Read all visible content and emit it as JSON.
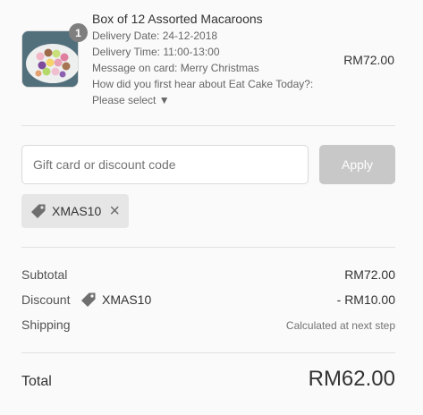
{
  "cart_item": {
    "quantity": "1",
    "title": "Box of 12 Assorted Macaroons",
    "properties": [
      "Delivery Date: 24-12-2018",
      "Delivery Time: 11:00-13:00",
      "Message on card: Merry Christmas",
      "How did you first hear about Eat Cake Today?:"
    ],
    "select_label": "Please select",
    "price": "RM72.00"
  },
  "discount": {
    "placeholder": "Gift card or discount code",
    "apply_label": "Apply",
    "applied_code": "XMAS10",
    "remove_icon": "×"
  },
  "summary": {
    "subtotal_label": "Subtotal",
    "subtotal_value": "RM72.00",
    "discount_label": "Discount",
    "discount_code": "XMAS10",
    "discount_value": "- RM10.00",
    "shipping_label": "Shipping",
    "shipping_value": "Calculated at next step",
    "total_label": "Total",
    "total_value": "RM62.00"
  },
  "colors": {
    "apply_disabled": "#c8c8c8",
    "chip_bg": "#e6e6e6",
    "badge_bg": "#7f7f7f"
  }
}
